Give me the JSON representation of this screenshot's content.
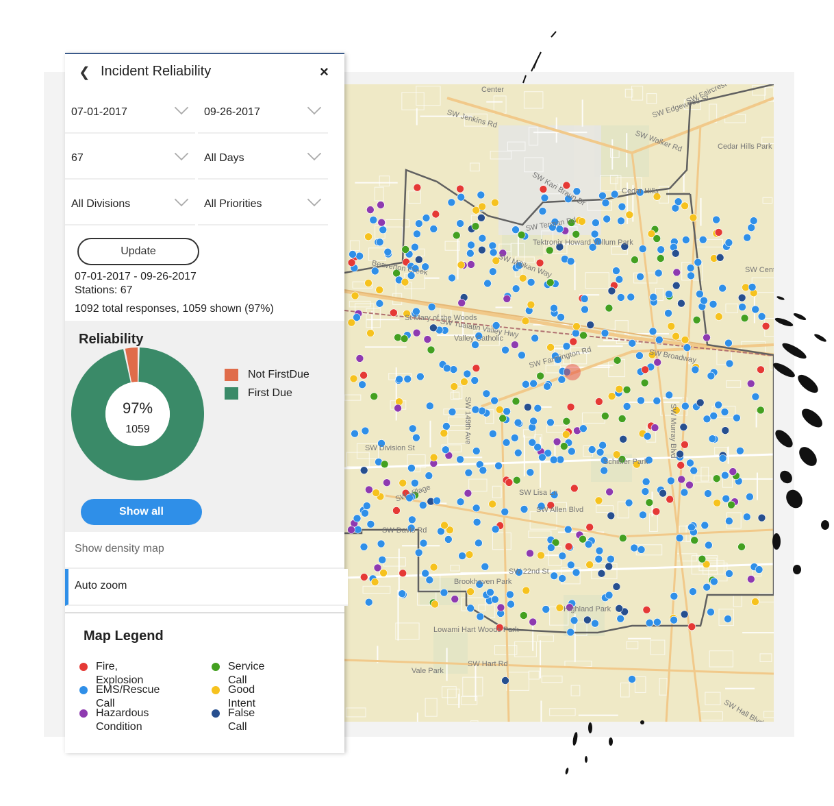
{
  "panel": {
    "title": "Incident Reliability",
    "back_icon": "chevron-left-icon",
    "close_label": "×",
    "filters": {
      "start_date": "07-01-2017",
      "end_date": "09-26-2017",
      "station": "67",
      "days": "All Days",
      "divisions": "All Divisions",
      "priorities": "All Priorities"
    },
    "update_label": "Update",
    "summary": {
      "date_range": "07-01-2017 - 09-26-2017",
      "stations": "Stations: 67",
      "responses": "1092 total responses, 1059 shown (97%)"
    },
    "reliability": {
      "title": "Reliability",
      "percent": "97%",
      "count": "1059",
      "first_due_fraction": 0.97,
      "legend": [
        {
          "label": "Not FirstDue",
          "color": "#e06c4a"
        },
        {
          "label": "First Due",
          "color": "#3a8a68"
        }
      ],
      "show_all_label": "Show all"
    },
    "options": {
      "density_map": "Show density map",
      "auto_zoom": "Auto zoom"
    }
  },
  "map_legend": {
    "title": "Map Legend",
    "items": [
      {
        "label": "Fire, Explosion",
        "color": "#e53935"
      },
      {
        "label": "Service Call",
        "color": "#43a020"
      },
      {
        "label": "EMS/Rescue Call",
        "color": "#2f8fe8"
      },
      {
        "label": "Good Intent",
        "color": "#f6c21e"
      },
      {
        "label": "Hazardous Condition",
        "color": "#8e3ab0"
      },
      {
        "label": "False Call",
        "color": "#274f8f"
      }
    ]
  },
  "map": {
    "labels": [
      "Center",
      "SW Jenkins Rd",
      "SW Faircrest St",
      "SW Edgewood St",
      "SW Walker Rd",
      "Cedar Hills Park",
      "SW Kari Braun Dr",
      "Cedar Hills",
      "SW Terman Rd",
      "Tektronix Howard Vollum Park",
      "SW Millikan Way",
      "SW Center",
      "Beaverton Creek",
      "SW Tualatin Valley Hwy",
      "St Mary of the Woods",
      "Valley Catholic",
      "SW Farmington Rd",
      "SW Broadway",
      "SW 149th Ave",
      "SW Division St",
      "SW Murray Blvd",
      "Schiffler Park",
      "SW Village",
      "SW Davis Rd",
      "SW Lisa Ln",
      "SW Allen Blvd",
      "SW 22nd St",
      "Brookhaven Park",
      "Highland Park",
      "Lowami Hart Woods Park",
      "SW Hart Rd",
      "SW Hall Blvd",
      "Vale Park"
    ]
  }
}
